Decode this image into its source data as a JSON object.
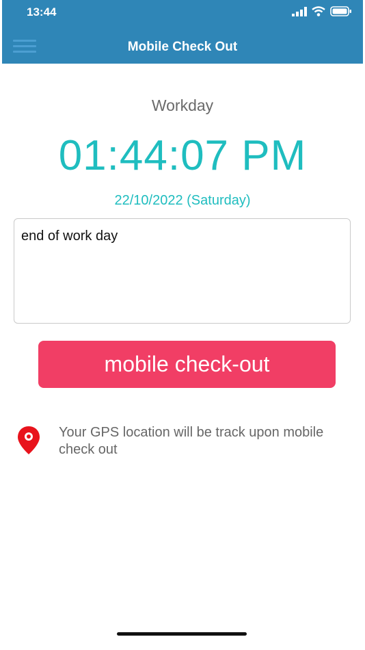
{
  "status_bar": {
    "time": "13:44",
    "icons": [
      "signal-icon",
      "wifi-icon",
      "battery-icon"
    ]
  },
  "header": {
    "title": "Mobile Check Out",
    "menu_icon": "menu-icon"
  },
  "main": {
    "workday_label": "Workday",
    "clock": "01:44:07 PM",
    "date": "22/10/2022 (Saturday)",
    "note_value": "end of work day",
    "checkout_button_label": "mobile check-out",
    "gps_notice": "Your GPS location will be track upon mobile check out"
  },
  "colors": {
    "header_bg": "#2f86b7",
    "accent_teal": "#1fbdbf",
    "button_pink": "#f13e65",
    "pin_red": "#e8131c"
  }
}
